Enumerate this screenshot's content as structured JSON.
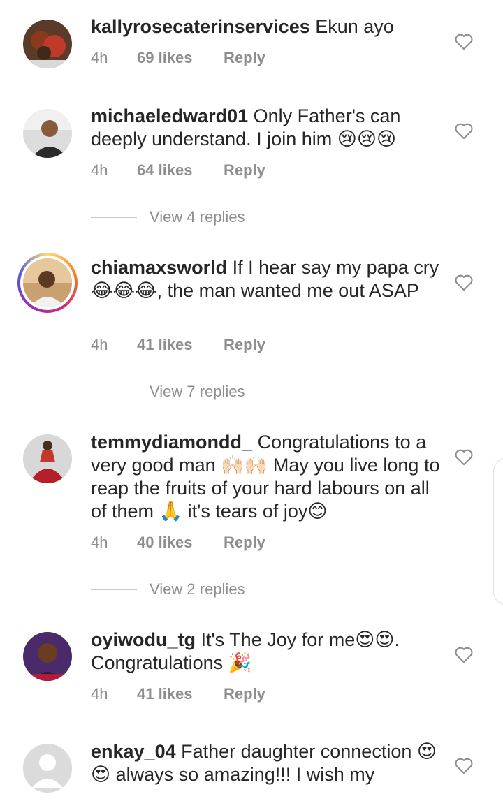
{
  "comments": [
    {
      "username": "kallyrosecaterinservices",
      "text": "Ekun ayo",
      "time": "4h",
      "likes": "69 likes",
      "reply": "Reply"
    },
    {
      "username": "michaeledward01",
      "text": "Only Father's can deeply understand. I join him 😢😢😢",
      "time": "4h",
      "likes": "64 likes",
      "reply": "Reply",
      "view_replies": "View 4 replies"
    },
    {
      "username": "chiamaxsworld",
      "text": "If I hear say my papa cry😂😂😂, the man wanted me out ASAP",
      "time": "4h",
      "likes": "41 likes",
      "reply": "Reply",
      "view_replies": "View 7 replies"
    },
    {
      "username": "temmydiamondd_",
      "text": "Congratulations to a very good man 🙌🏻🙌🏻 May you live long to reap the fruits of your hard labours on all of them 🙏 it's tears of joy😊",
      "time": "4h",
      "likes": "40 likes",
      "reply": "Reply",
      "view_replies": "View 2 replies"
    },
    {
      "username": "oyiwodu_tg",
      "text": "It's The Joy for me😍😍. Congratulations 🎉",
      "time": "4h",
      "likes": "41 likes",
      "reply": "Reply"
    },
    {
      "username": "enkay_04",
      "text": "Father daughter connection 😍😍 always so amazing!!! I wish my"
    }
  ]
}
